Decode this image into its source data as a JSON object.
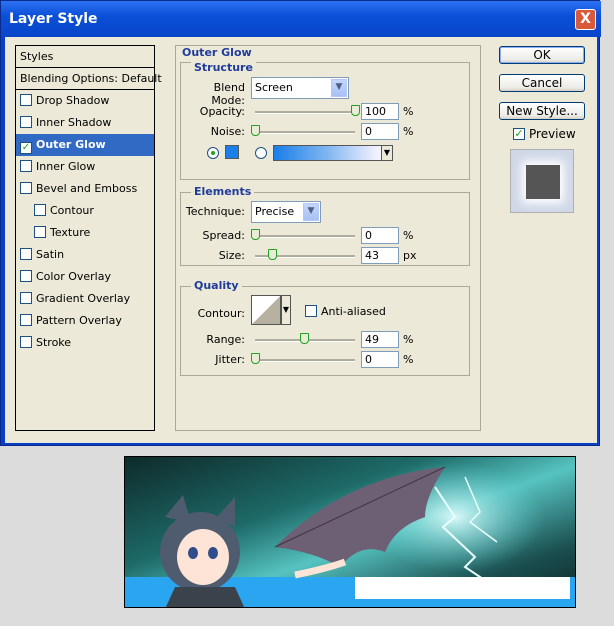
{
  "window": {
    "title": "Layer Style",
    "close_label": "X"
  },
  "styles_list": {
    "header": "Styles",
    "blending": "Blending Options: Default",
    "items": [
      {
        "label": "Drop Shadow",
        "checked": false,
        "indent": false
      },
      {
        "label": "Inner Shadow",
        "checked": false,
        "indent": false
      },
      {
        "label": "Outer Glow",
        "checked": true,
        "indent": false,
        "selected": true
      },
      {
        "label": "Inner Glow",
        "checked": false,
        "indent": false
      },
      {
        "label": "Bevel and Emboss",
        "checked": false,
        "indent": false
      },
      {
        "label": "Contour",
        "checked": false,
        "indent": true
      },
      {
        "label": "Texture",
        "checked": false,
        "indent": true
      },
      {
        "label": "Satin",
        "checked": false,
        "indent": false
      },
      {
        "label": "Color Overlay",
        "checked": false,
        "indent": false
      },
      {
        "label": "Gradient Overlay",
        "checked": false,
        "indent": false
      },
      {
        "label": "Pattern Overlay",
        "checked": false,
        "indent": false
      },
      {
        "label": "Stroke",
        "checked": false,
        "indent": false
      }
    ]
  },
  "panel": {
    "title": "Outer Glow",
    "structure": {
      "title": "Structure",
      "blend_mode_label": "Blend Mode:",
      "blend_mode_value": "Screen",
      "opacity_label": "Opacity:",
      "opacity_value": "100",
      "opacity_level": 100,
      "noise_label": "Noise:",
      "noise_value": "0",
      "noise_level": 0,
      "unit": "%",
      "glow_color": "#1a7ee8"
    },
    "elements": {
      "title": "Elements",
      "technique_label": "Technique:",
      "technique_value": "Precise",
      "spread_label": "Spread:",
      "spread_value": "0",
      "spread_level": 0,
      "spread_unit": "%",
      "size_label": "Size:",
      "size_value": "43",
      "size_level": 17,
      "size_unit": "px"
    },
    "quality": {
      "title": "Quality",
      "contour_label": "Contour:",
      "anti_aliased_label": "Anti-aliased",
      "anti_aliased_checked": false,
      "range_label": "Range:",
      "range_value": "49",
      "range_level": 49,
      "jitter_label": "Jitter:",
      "jitter_value": "0",
      "jitter_level": 0,
      "unit": "%"
    }
  },
  "buttons": {
    "ok": "OK",
    "cancel": "Cancel",
    "new_style": "New Style...",
    "preview": "Preview",
    "preview_checked": true
  }
}
